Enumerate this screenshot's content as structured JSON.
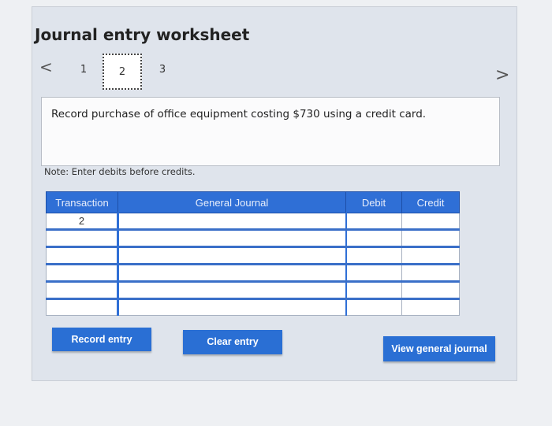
{
  "header": {
    "title": "Journal entry worksheet"
  },
  "nav": {
    "prev_symbol": "<",
    "next_symbol": ">",
    "steps": [
      "1",
      "2",
      "3"
    ],
    "current_step": "2"
  },
  "prompt": {
    "text": "Record purchase of office equipment costing $730 using a credit card."
  },
  "note": "Note: Enter debits before credits.",
  "table": {
    "headers": {
      "transaction": "Transaction",
      "general_journal": "General Journal",
      "debit": "Debit",
      "credit": "Credit"
    },
    "rows": [
      {
        "transaction": "2",
        "general_journal": "",
        "debit": "",
        "credit": ""
      },
      {
        "transaction": "",
        "general_journal": "",
        "debit": "",
        "credit": ""
      },
      {
        "transaction": "",
        "general_journal": "",
        "debit": "",
        "credit": ""
      },
      {
        "transaction": "",
        "general_journal": "",
        "debit": "",
        "credit": ""
      },
      {
        "transaction": "",
        "general_journal": "",
        "debit": "",
        "credit": ""
      },
      {
        "transaction": "",
        "general_journal": "",
        "debit": "",
        "credit": ""
      }
    ]
  },
  "buttons": {
    "record": "Record entry",
    "clear": "Clear entry",
    "view": "View general journal"
  },
  "colors": {
    "accent": "#2f6fd6",
    "button": "#2a6fd4"
  }
}
